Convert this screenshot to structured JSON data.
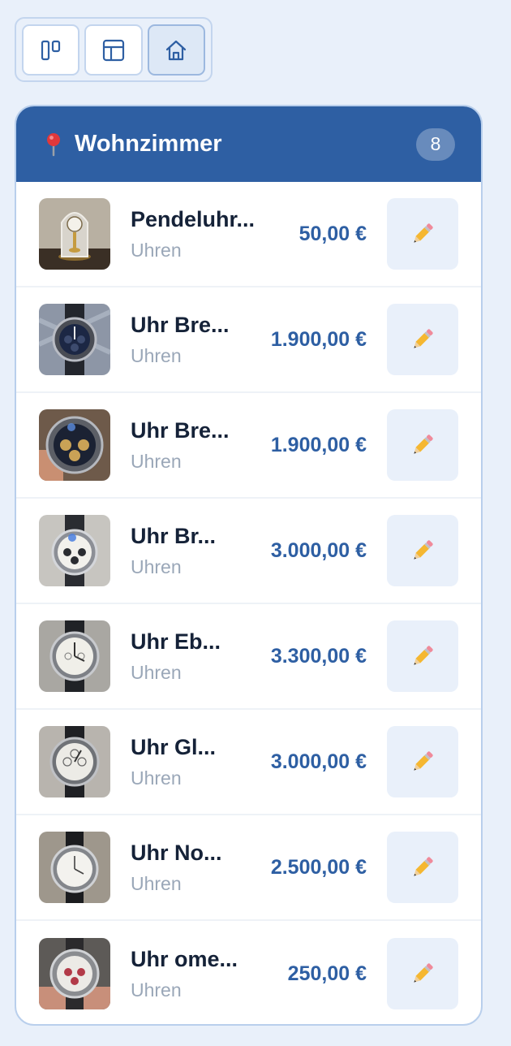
{
  "toolbar": {
    "views": [
      {
        "name": "board-view",
        "icon": "kanban-columns-icon",
        "active": false
      },
      {
        "name": "table-view",
        "icon": "table-layout-icon",
        "active": false
      },
      {
        "name": "home-view",
        "icon": "house-icon",
        "active": true
      }
    ]
  },
  "room": {
    "icon": "map-pin-icon",
    "title": "Wohnzimmer",
    "count": "8",
    "items": [
      {
        "name": "Pendeluhr...",
        "category": "Uhren",
        "price": "50,00 €",
        "thumb": "pendulum-clock"
      },
      {
        "name": "Uhr Bre...",
        "category": "Uhren",
        "price": "1.900,00 €",
        "thumb": "dark-chronograph"
      },
      {
        "name": "Uhr Bre...",
        "category": "Uhren",
        "price": "1.900,00 €",
        "thumb": "gold-chronograph"
      },
      {
        "name": "Uhr Br...",
        "category": "Uhren",
        "price": "3.000,00 €",
        "thumb": "white-chronograph"
      },
      {
        "name": "Uhr Eb...",
        "category": "Uhren",
        "price": "3.300,00 €",
        "thumb": "white-dial-watch"
      },
      {
        "name": "Uhr Gl...",
        "category": "Uhren",
        "price": "3.000,00 €",
        "thumb": "white-dial-watch"
      },
      {
        "name": "Uhr No...",
        "category": "Uhren",
        "price": "2.500,00 €",
        "thumb": "white-dial-watch"
      },
      {
        "name": "Uhr ome...",
        "category": "Uhren",
        "price": "250,00 €",
        "thumb": "red-chronograph"
      }
    ]
  },
  "colors": {
    "accent": "#2e5fa3",
    "background": "#e9f0fa",
    "title_text": "#152238",
    "muted_text": "#9aa7b8"
  }
}
